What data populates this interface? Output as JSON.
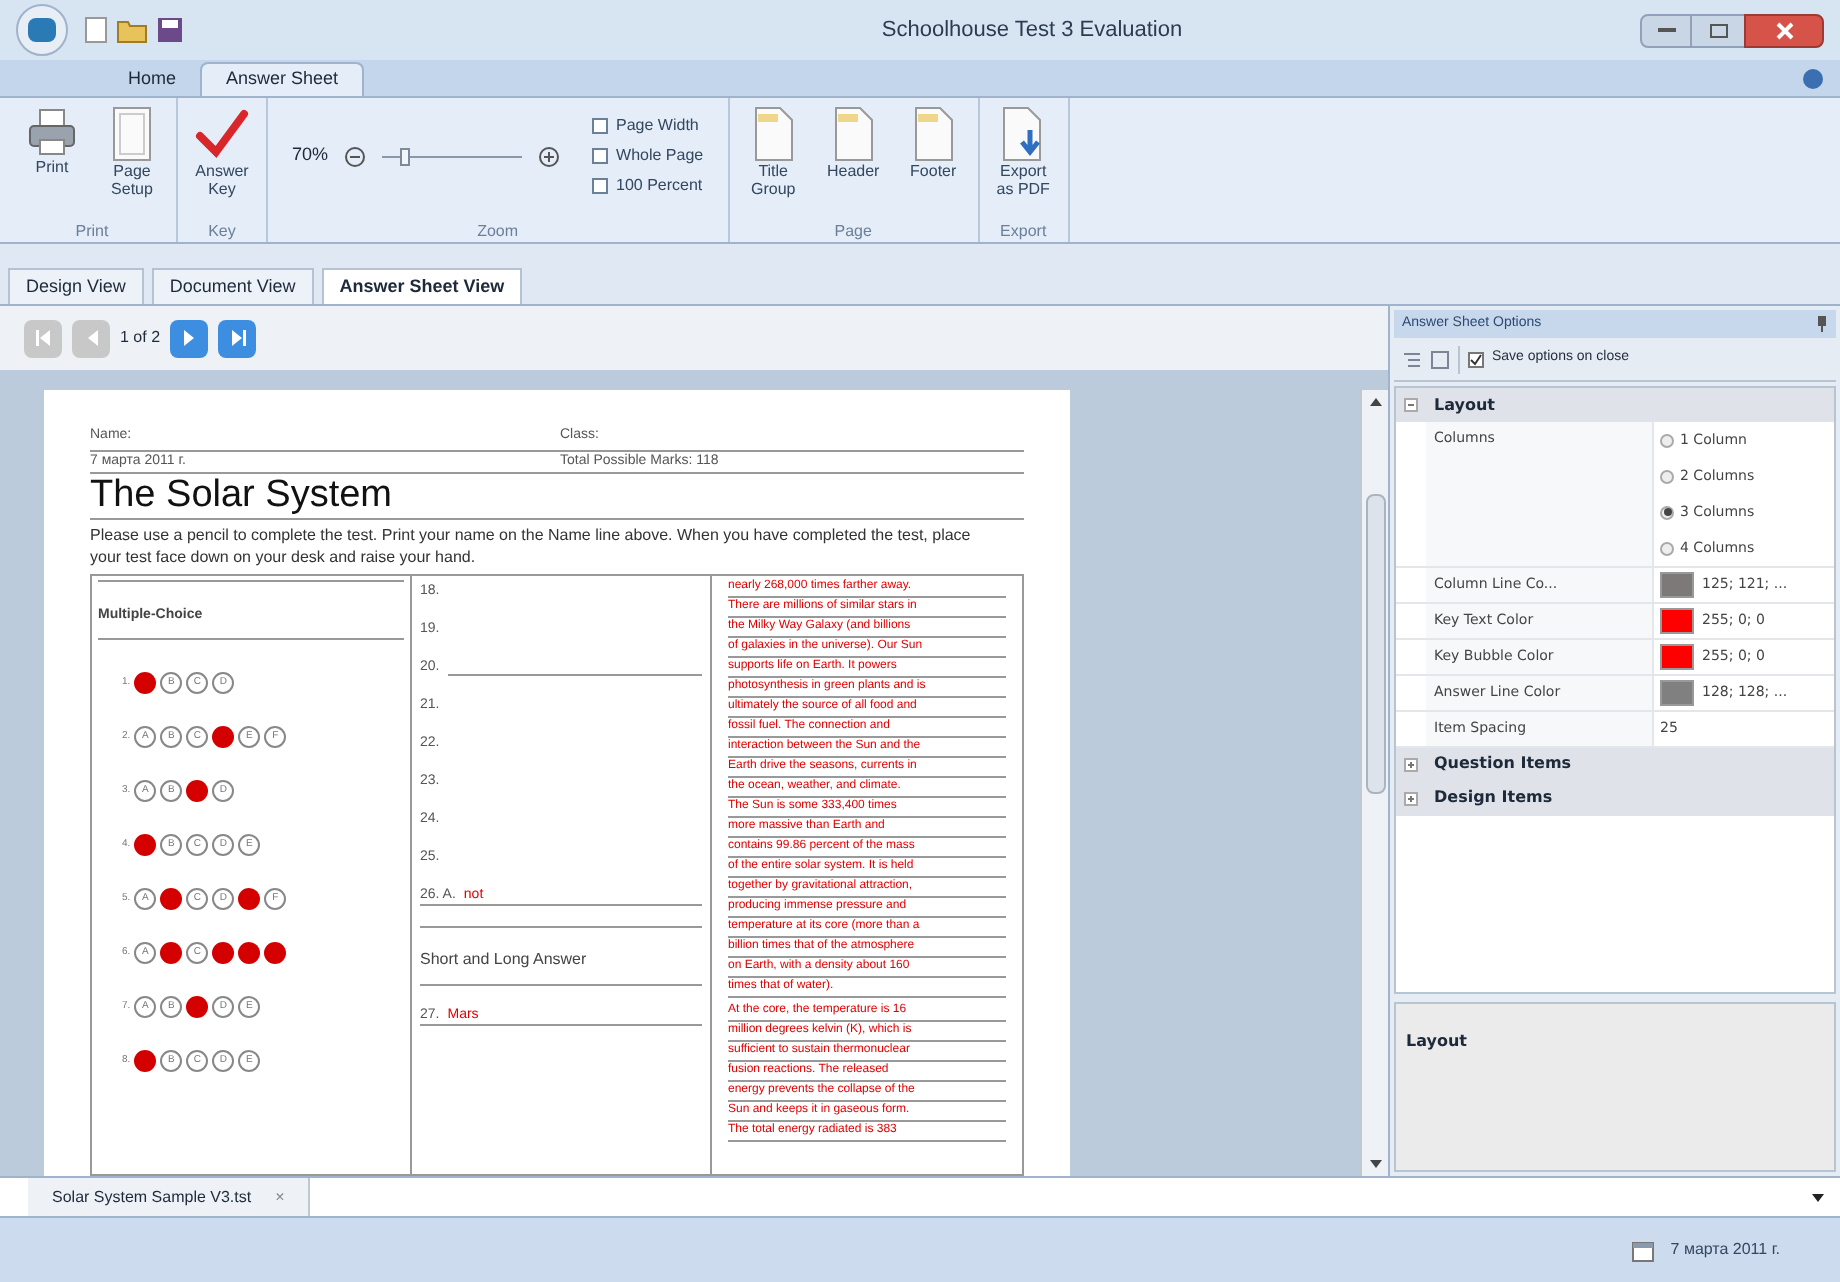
{
  "window": {
    "title": "Schoolhouse Test 3 Evaluation"
  },
  "ribbon_tabs": [
    {
      "label": "Home",
      "selected": false
    },
    {
      "label": "Answer Sheet",
      "selected": true
    }
  ],
  "ribbon_groups": [
    {
      "label": "Print",
      "items": [
        {
          "kind": "printer",
          "label": "Print"
        },
        {
          "kind": "page",
          "label": "Page Setup"
        }
      ]
    },
    {
      "label": "Key",
      "items": [
        {
          "kind": "check",
          "label": "Answer Key"
        }
      ]
    },
    {
      "label": "Zoom",
      "zoom": {
        "percent": "70%",
        "level": 0.15,
        "options": [
          "Page Width",
          "Whole Page",
          "100 Percent"
        ]
      }
    },
    {
      "label": "Page",
      "items": [
        {
          "kind": "doc",
          "label": "Title Group"
        },
        {
          "kind": "doc",
          "label": "Header"
        },
        {
          "kind": "doc",
          "label": "Footer"
        }
      ]
    },
    {
      "label": "Export",
      "items": [
        {
          "kind": "export",
          "label": "Export as PDF"
        }
      ]
    }
  ],
  "view_tabs": [
    {
      "label": "Design View",
      "selected": false
    },
    {
      "label": "Document View",
      "selected": false
    },
    {
      "label": "Answer Sheet View",
      "selected": true
    }
  ],
  "pager": {
    "page": "1 of 2",
    "first_disabled": true,
    "prev_disabled": true,
    "next_disabled": false,
    "last_disabled": false
  },
  "sheet": {
    "name_label": "Name:",
    "class_label": "Class:",
    "date": "7 марта 2011 г.",
    "total": "Total Possible Marks: 118",
    "title": "The Solar System",
    "instructions": "Please use a pencil to complete the test. Print your name on the Name line above. When you have completed the test, place your test face down on your desk and raise your hand.",
    "mc_header": "Multiple-Choice",
    "questions": [
      {
        "number": "1.",
        "bubbles": [
          {
            "filled": true
          },
          {
            "letter": "B",
            "filled": false
          },
          {
            "letter": "C",
            "filled": false
          },
          {
            "letter": "D",
            "filled": false
          }
        ]
      },
      {
        "number": "2.",
        "bubbles": [
          {
            "letter": "A",
            "filled": false
          },
          {
            "letter": "B",
            "filled": false
          },
          {
            "letter": "C",
            "filled": false
          },
          {
            "filled": true
          },
          {
            "letter": "E",
            "filled": false
          },
          {
            "letter": "F",
            "filled": false
          }
        ]
      },
      {
        "number": "3.",
        "bubbles": [
          {
            "letter": "A",
            "filled": false
          },
          {
            "letter": "B",
            "filled": false
          },
          {
            "filled": true
          },
          {
            "letter": "D",
            "filled": false
          }
        ]
      },
      {
        "number": "4.",
        "bubbles": [
          {
            "filled": true
          },
          {
            "letter": "B",
            "filled": false
          },
          {
            "letter": "C",
            "filled": false
          },
          {
            "letter": "D",
            "filled": false
          },
          {
            "letter": "E",
            "filled": false
          }
        ]
      },
      {
        "number": "5.",
        "bubbles": [
          {
            "letter": "A",
            "filled": false
          },
          {
            "filled": true
          },
          {
            "letter": "C",
            "filled": false
          },
          {
            "letter": "D",
            "filled": false
          },
          {
            "filled": true
          },
          {
            "letter": "F",
            "filled": false
          }
        ]
      },
      {
        "number": "6.",
        "bubbles": [
          {
            "letter": "A",
            "filled": false
          },
          {
            "filled": true
          },
          {
            "letter": "C",
            "filled": false
          },
          {
            "filled": true
          },
          {
            "filled": true
          },
          {
            "filled": true
          }
        ]
      },
      {
        "number": "7.",
        "bubbles": [
          {
            "letter": "A",
            "filled": false
          },
          {
            "letter": "B",
            "filled": false
          },
          {
            "filled": true
          },
          {
            "letter": "D",
            "filled": false
          },
          {
            "letter": "E",
            "filled": false
          }
        ]
      },
      {
        "number": "8.",
        "bubbles": [
          {
            "filled": true
          },
          {
            "letter": "B",
            "filled": false
          },
          {
            "letter": "C",
            "filled": false
          },
          {
            "letter": "D",
            "filled": false
          },
          {
            "letter": "E",
            "filled": false
          }
        ]
      }
    ],
    "items": [
      {
        "kind": "plain",
        "number": "18."
      },
      {
        "kind": "plain",
        "number": "19."
      },
      {
        "kind": "line",
        "number": "20."
      },
      {
        "kind": "plain",
        "number": "21."
      },
      {
        "kind": "plain",
        "number": "22."
      },
      {
        "kind": "plain",
        "number": "23."
      },
      {
        "kind": "plain",
        "number": "24."
      },
      {
        "kind": "plain",
        "number": "25."
      },
      {
        "kind": "answer",
        "number": "26. A.",
        "answer": "not"
      },
      {
        "kind": "header",
        "number": "Short and Long Answer"
      },
      {
        "kind": "answer",
        "number": "27.",
        "answer": "Mars"
      }
    ],
    "answer_paragraphs": [
      [
        "nearly 268,000 times farther away.",
        "There are millions of similar stars in",
        "the Milky Way Galaxy (and billions",
        "of galaxies in the universe). Our Sun",
        "supports life on Earth. It powers",
        "photosynthesis in green plants and is",
        "ultimately the source of all food and",
        "fossil fuel. The connection and",
        "interaction between the Sun and the",
        "Earth drive the seasons, currents in",
        "the ocean, weather, and climate.",
        "The Sun is some 333,400 times",
        "more massive than Earth and",
        "contains 99.86 percent of the mass",
        "of the entire solar system. It is held",
        "together by gravitational attraction,",
        "producing immense pressure and",
        "temperature at its core (more than a",
        "billion times that of the atmosphere",
        "on Earth, with a density about 160",
        "times that of water)."
      ],
      [
        "At the core, the temperature is 16",
        "million degrees kelvin (K), which is",
        "sufficient to sustain thermonuclear",
        "fusion reactions. The released",
        "energy prevents the collapse of the",
        "Sun and keeps it in gaseous form.",
        "The total energy radiated is 383"
      ]
    ]
  },
  "options_panel": {
    "title": "Answer Sheet Options",
    "save_on_close": {
      "label": "Save options on close",
      "checked": true
    },
    "categories": [
      {
        "label": "Layout",
        "expanded": true,
        "rows": [
          {
            "kind": "radio",
            "label": "Columns",
            "options": [
              {
                "label": "1 Column",
                "selected": false
              },
              {
                "label": "2 Columns",
                "selected": false
              },
              {
                "label": "3 Columns",
                "selected": true
              },
              {
                "label": "4 Columns",
                "selected": false
              }
            ]
          },
          {
            "kind": "color",
            "label": "Column Line Co...",
            "color": "#7d7979",
            "value": "125; 121; ..."
          },
          {
            "kind": "color",
            "label": "Key Text Color",
            "color": "#ff0000",
            "value": "255; 0; 0"
          },
          {
            "kind": "color",
            "label": "Key Bubble Color",
            "color": "#ff0000",
            "value": "255; 0; 0"
          },
          {
            "kind": "color",
            "label": "Answer Line Color",
            "color": "#808080",
            "value": "128; 128; ..."
          },
          {
            "kind": "text",
            "label": "Item Spacing",
            "value": "25"
          }
        ]
      },
      {
        "label": "Question Items",
        "expanded": false
      },
      {
        "label": "Design Items",
        "expanded": false
      }
    ],
    "description_title": "Layout"
  },
  "doc_tabs": [
    {
      "label": "Solar System Sample V3.tst",
      "close": "×"
    }
  ],
  "status_bar": {
    "date": "7 марта 2011 г."
  }
}
